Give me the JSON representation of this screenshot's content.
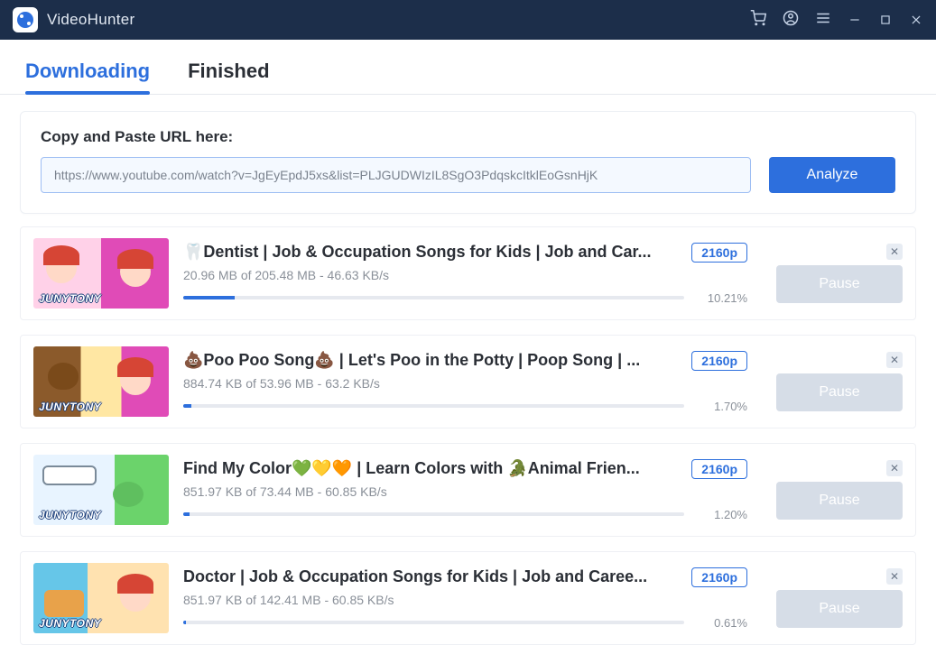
{
  "app": {
    "title": "VideoHunter"
  },
  "tabs": {
    "downloading": "Downloading",
    "finished": "Finished",
    "active": "downloading"
  },
  "url_card": {
    "label": "Copy and Paste URL here:",
    "value": "https://www.youtube.com/watch?v=JgEyEpdJ5xs&list=PLJGUDWIzIL8SgO3PdqskcItklEoGsnHjK",
    "analyze_label": "Analyze"
  },
  "thumb_brand": "JUNYTONY",
  "items": [
    {
      "title": "🦷Dentist | Job & Occupation Songs for Kids | Job and Car...",
      "quality": "2160p",
      "stats": "20.96 MB of 205.48 MB - 46.63 KB/s",
      "percent": "10.21%",
      "progress_css_width": "10.21%",
      "pause_label": "Pause"
    },
    {
      "title": "💩Poo Poo Song💩 | Let's Poo in the Potty | Poop Song | ...",
      "quality": "2160p",
      "stats": "884.74 KB of 53.96 MB - 63.2 KB/s",
      "percent": "1.70%",
      "progress_css_width": "1.70%",
      "pause_label": "Pause"
    },
    {
      "title": "Find My Color💚💛🧡 | Learn Colors with 🐊Animal Frien...",
      "quality": "2160p",
      "stats": "851.97 KB of 73.44 MB - 60.85 KB/s",
      "percent": "1.20%",
      "progress_css_width": "1.20%",
      "pause_label": "Pause"
    },
    {
      "title": "Doctor | Job & Occupation Songs for Kids | Job and Caree...",
      "quality": "2160p",
      "stats": "851.97 KB of 142.41 MB - 60.85 KB/s",
      "percent": "0.61%",
      "progress_css_width": "0.61%",
      "pause_label": "Pause"
    }
  ]
}
